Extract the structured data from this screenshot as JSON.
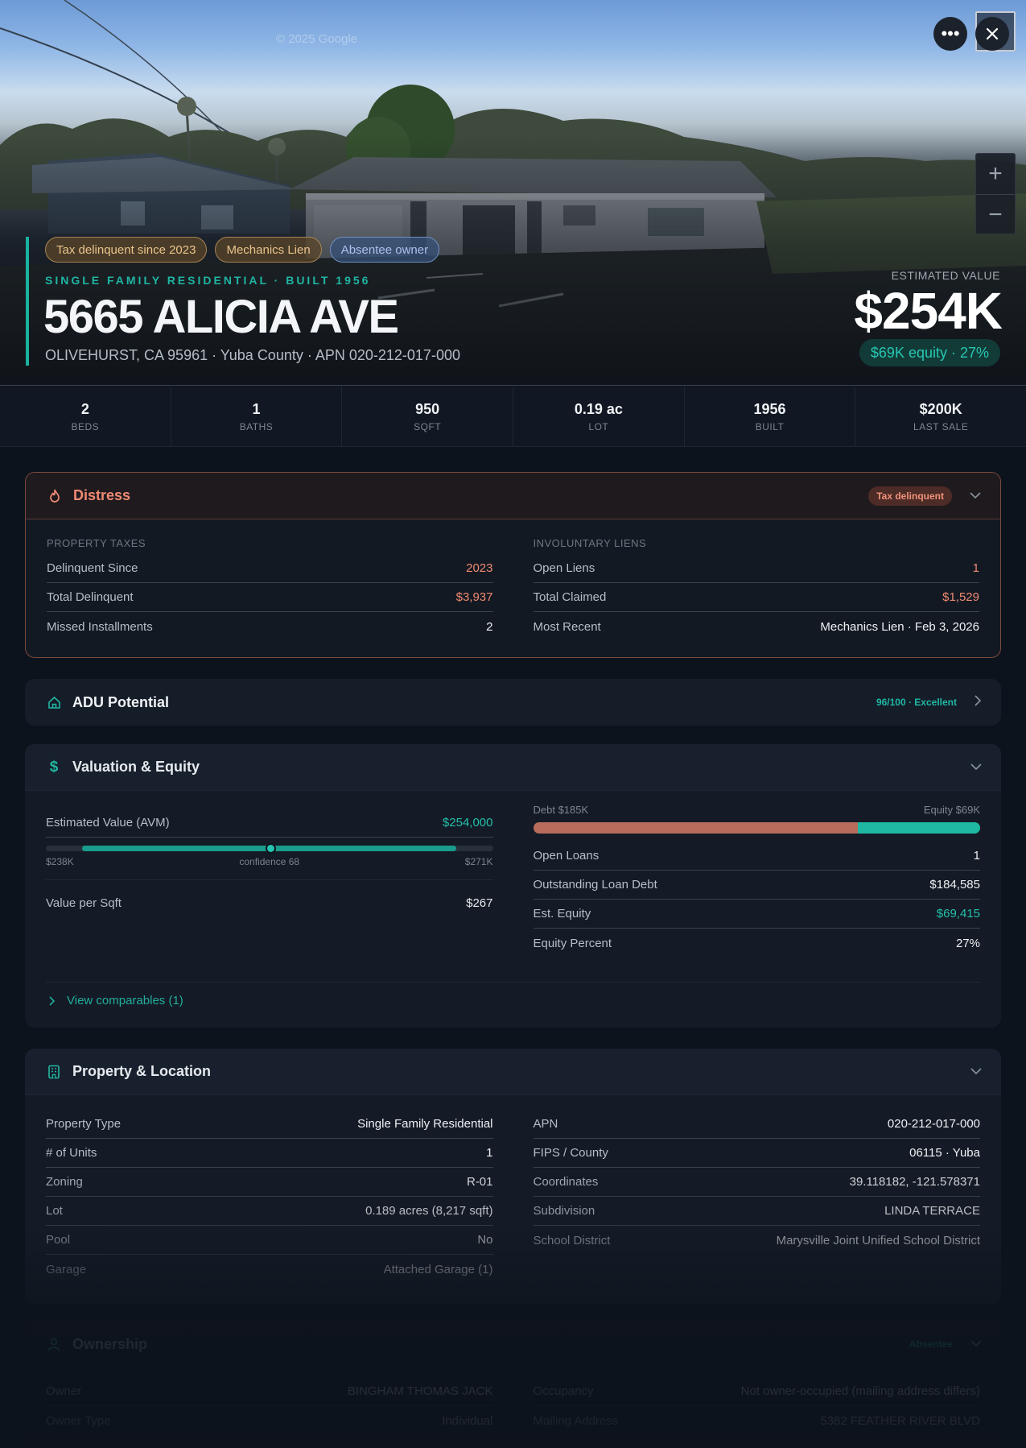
{
  "hero": {
    "watermark": "© 2025 Google",
    "tags": [
      "Tax delinquent since 2023",
      "Mechanics Lien",
      "Absentee owner"
    ],
    "subtitle": "SINGLE FAMILY RESIDENTIAL · BUILT 1956",
    "address": "5665 ALICIA AVE",
    "location": "OLIVEHURST, CA 95961 · Yuba County · APN 020-212-017-000",
    "est_label": "ESTIMATED VALUE",
    "est_value": "$254K",
    "equity": "$69K equity · 27%"
  },
  "stats": [
    {
      "value": "2",
      "label": "BEDS"
    },
    {
      "value": "1",
      "label": "BATHS"
    },
    {
      "value": "950",
      "label": "SQFT"
    },
    {
      "value": "0.19 ac",
      "label": "LOT"
    },
    {
      "value": "1956",
      "label": "BUILT"
    },
    {
      "value": "$200K",
      "label": "LAST SALE"
    }
  ],
  "distress": {
    "title": "Distress",
    "badge": "Tax delinquent",
    "taxes": {
      "label": "PROPERTY TAXES",
      "rows": [
        {
          "k": "Delinquent Since",
          "v": "2023"
        },
        {
          "k": "Total Delinquent",
          "v": "$3,937"
        },
        {
          "k": "Missed Installments",
          "v": "2"
        }
      ]
    },
    "liens": {
      "label": "INVOLUNTARY LIENS",
      "rows": [
        {
          "k": "Open Liens",
          "v": "1"
        },
        {
          "k": "Total Claimed",
          "v": "$1,529"
        },
        {
          "k": "Most Recent",
          "v": "Mechanics Lien · Feb 3, 2026"
        }
      ]
    }
  },
  "adu": {
    "title": "ADU Potential",
    "score": "96/100 · Excellent"
  },
  "valuation": {
    "title": "Valuation & Equity",
    "avm_label": "Estimated Value (AVM)",
    "avm_value": "$254,000",
    "range_low": "$238K",
    "confidence": "confidence 68",
    "range_high": "$271K",
    "vps_label": "Value per Sqft",
    "vps_value": "$267",
    "debt_label": "Debt $185K",
    "equity_label": "Equity $69K",
    "rows": [
      {
        "k": "Open Loans",
        "v": "1"
      },
      {
        "k": "Outstanding Loan Debt",
        "v": "$184,585"
      },
      {
        "k": "Est. Equity",
        "v": "$69,415"
      },
      {
        "k": "Equity Percent",
        "v": "27%"
      }
    ],
    "comparables": "View comparables (1)"
  },
  "property": {
    "title": "Property & Location",
    "left": [
      {
        "k": "Property Type",
        "v": "Single Family Residential"
      },
      {
        "k": "# of Units",
        "v": "1"
      },
      {
        "k": "Zoning",
        "v": "R-01"
      },
      {
        "k": "Lot",
        "v": "0.189 acres (8,217 sqft)"
      },
      {
        "k": "Pool",
        "v": "No"
      },
      {
        "k": "Garage",
        "v": "Attached Garage (1)"
      }
    ],
    "right": [
      {
        "k": "APN",
        "v": "020-212-017-000"
      },
      {
        "k": "FIPS / County",
        "v": "06115 · Yuba"
      },
      {
        "k": "Coordinates",
        "v": "39.118182, -121.578371"
      },
      {
        "k": "Subdivision",
        "v": "LINDA TERRACE"
      },
      {
        "k": "School District",
        "v": "Marysville Joint Unified School District"
      }
    ]
  },
  "ownership": {
    "title": "Ownership",
    "badge": "Absentee",
    "left": [
      {
        "k": "Owner",
        "v": "BINGHAM THOMAS JACK"
      },
      {
        "k": "Owner Type",
        "v": "Individual"
      }
    ],
    "right": [
      {
        "k": "Occupancy",
        "v": "Not owner-occupied (mailing address differs)"
      },
      {
        "k": "Mailing Address",
        "v": "5382 FEATHER RIVER BLVD"
      }
    ]
  },
  "colors": {
    "accent": "#1fb5a3",
    "distress": "#ef8a73",
    "bg": "#0d131c"
  },
  "icons": [
    "more-icon",
    "close-icon",
    "zoom-in-icon",
    "zoom-out-icon",
    "flame-icon",
    "home-icon",
    "dollar-icon",
    "building-icon",
    "user-icon",
    "chevron-down-icon",
    "chevron-right-icon"
  ]
}
